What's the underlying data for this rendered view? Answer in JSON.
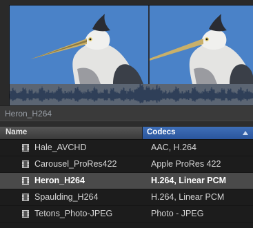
{
  "viewer": {
    "clip_title": "Heron_H264"
  },
  "table": {
    "columns": {
      "name": "Name",
      "codecs": "Codecs"
    },
    "rows": [
      {
        "name": "Hale_AVCHD",
        "codecs": "AAC, H.264",
        "selected": false,
        "icon": "film-icon"
      },
      {
        "name": "Carousel_ProRes422",
        "codecs": "Apple ProRes 422",
        "selected": false,
        "icon": "film-icon"
      },
      {
        "name": "Heron_H264",
        "codecs": "H.264, Linear PCM",
        "selected": true,
        "icon": "film-icon"
      },
      {
        "name": "Spaulding_H264",
        "codecs": "H.264, Linear PCM",
        "selected": false,
        "icon": "film-icon"
      },
      {
        "name": "Tetons_Photo-JPEG",
        "codecs": "Photo - JPEG",
        "selected": false,
        "icon": "film-icon"
      }
    ]
  },
  "colors": {
    "sorted_column_header": "#2f5fa8",
    "selected_row": "#4a4a4a",
    "background": "#1c1c1c"
  }
}
